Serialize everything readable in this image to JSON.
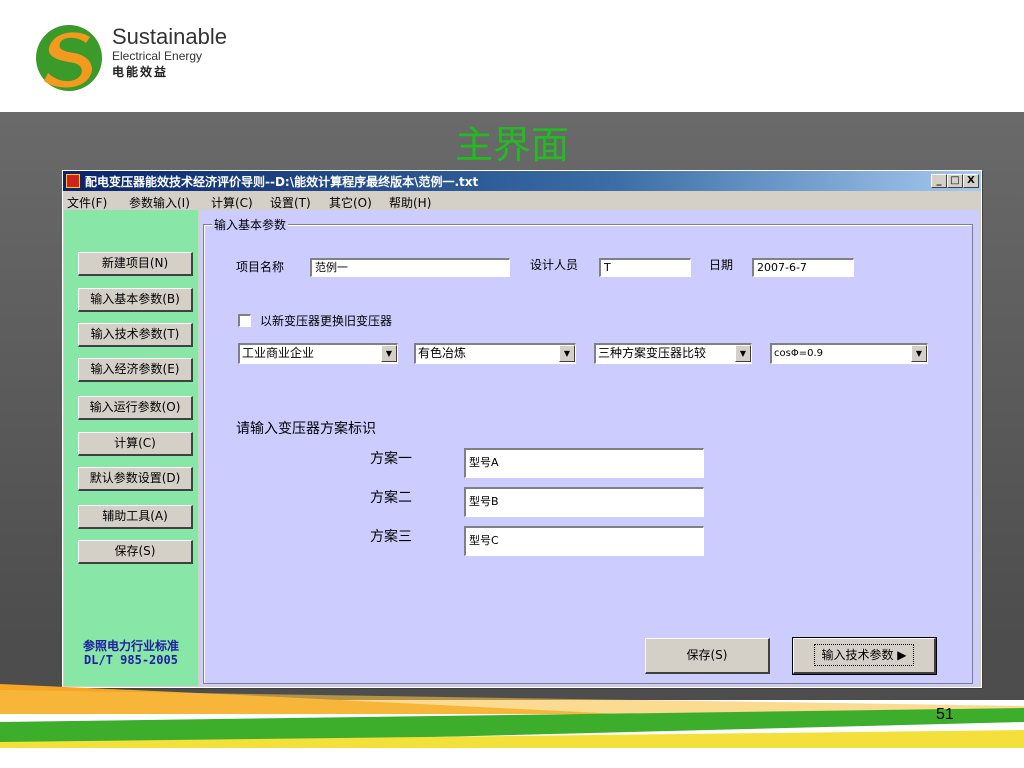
{
  "logo": {
    "line1": "Sustainable",
    "line2": "Electrical  Energy",
    "line3": "电能效益"
  },
  "slide": {
    "title": "主界面",
    "page_number": "51"
  },
  "window": {
    "title": "配电变压器能效技术经济评价导则--D:\\能效计算程序最终版本\\范例一.txt",
    "controls": [
      "_",
      "□",
      "X"
    ]
  },
  "menu": [
    "文件(F)",
    "参数输入(I)",
    "计算(C)",
    "设置(T)",
    "其它(O)",
    "帮助(H)"
  ],
  "nav": {
    "buttons": [
      "新建项目(N)",
      "输入基本参数(B)",
      "输入技术参数(T)",
      "输入经济参数(E)",
      "输入运行参数(O)",
      "计算(C)",
      "默认参数设置(D)",
      "辅助工具(A)",
      "保存(S)"
    ],
    "standard_line1": "参照电力行业标准",
    "standard_line2": "DL/T 985-2005"
  },
  "form": {
    "group_title": "输入基本参数",
    "project_label": "项目名称",
    "project_value": "范例一",
    "designer_label": "设计人员",
    "designer_value": "T",
    "date_label": "日期",
    "date_value": "2007-6-7",
    "replace_checkbox_label": "以新变压器更换旧变压器",
    "replace_checked": false,
    "combos": [
      "工业商业企业",
      "有色冶炼",
      "三种方案变压器比较",
      "cosΦ=0.9"
    ],
    "scheme_prompt": "请输入变压器方案标识",
    "schemes": [
      {
        "label": "方案一",
        "value": "型号A"
      },
      {
        "label": "方案二",
        "value": "型号B"
      },
      {
        "label": "方案三",
        "value": "型号C"
      }
    ],
    "save_button": "保存(S)",
    "next_button": "输入技术参数",
    "next_arrow": "▶"
  },
  "colors": {
    "slide_title": "#22bb22",
    "left_panel": "#88e6a6",
    "right_panel": "#ccccff",
    "standard_text": "#2020a0"
  }
}
